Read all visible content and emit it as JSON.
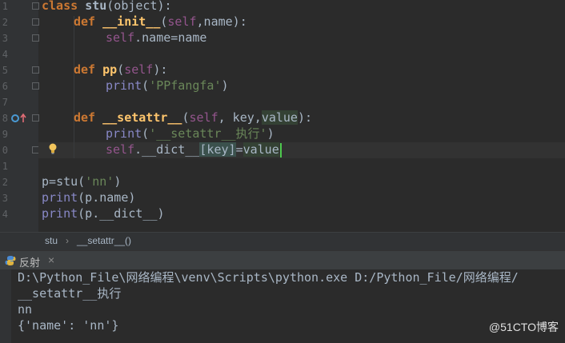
{
  "editor": {
    "line_numbers": [
      "1",
      "2",
      "3",
      "4",
      "5",
      "6",
      "7",
      "8",
      "9",
      "0",
      "1",
      "2",
      "3",
      "4"
    ],
    "code": {
      "l1_kw": "class",
      "l1_name": "stu",
      "l1_paren": "(object):",
      "l2_kw": "def",
      "l2_fn": "__init__",
      "l2_open": "(",
      "l2_self": "self",
      "l2_rest": ",name):",
      "l3_self": "self",
      "l3_rest": ".name",
      "l3_eq": "=",
      "l3_val": "name",
      "l5_kw": "def",
      "l5_fn": "pp",
      "l5_open": "(",
      "l5_self": "self",
      "l5_close": "):",
      "l6_print": "print",
      "l6_str": "'PPfangfa'",
      "l6_close": ")",
      "l8_kw": "def",
      "l8_fn": "__setattr__",
      "l8_open": "(",
      "l8_self": "self",
      "l8_rest": ", key,",
      "l8_val": "value",
      "l8_close": "):",
      "l9_print": "print",
      "l9_str": "'__setattr__执行'",
      "l9_close": ")",
      "l10_self": "self",
      "l10_dict": ".__dict__",
      "l10_key": "[key]",
      "l10_eq": "=",
      "l10_val": "value",
      "l12_p": "p",
      "l12_eq": "=",
      "l12_stu": "stu(",
      "l12_str": "'nn'",
      "l12_close": ")",
      "l13_print": "print",
      "l13_rest": "(p.name)",
      "l14_print": "print",
      "l14_rest": "(p.__dict__)"
    }
  },
  "breadcrumb": {
    "item1": "stu",
    "sep": "›",
    "item2": "__setattr__()"
  },
  "run_panel": {
    "tab_label": "反射",
    "close_label": "×"
  },
  "console": {
    "lines": [
      "D:\\Python_File\\网络编程\\venv\\Scripts\\python.exe D:/Python_File/网络编程/",
      "__setattr__执行",
      "nn",
      "{'name': 'nn'}"
    ]
  },
  "watermark": "@51CTO博客",
  "colors": {
    "background": "#2b2b2b",
    "keyword": "#cc7832",
    "function": "#ffc66d",
    "self": "#94558d",
    "string": "#6a8759",
    "builtin": "#8888c6"
  }
}
